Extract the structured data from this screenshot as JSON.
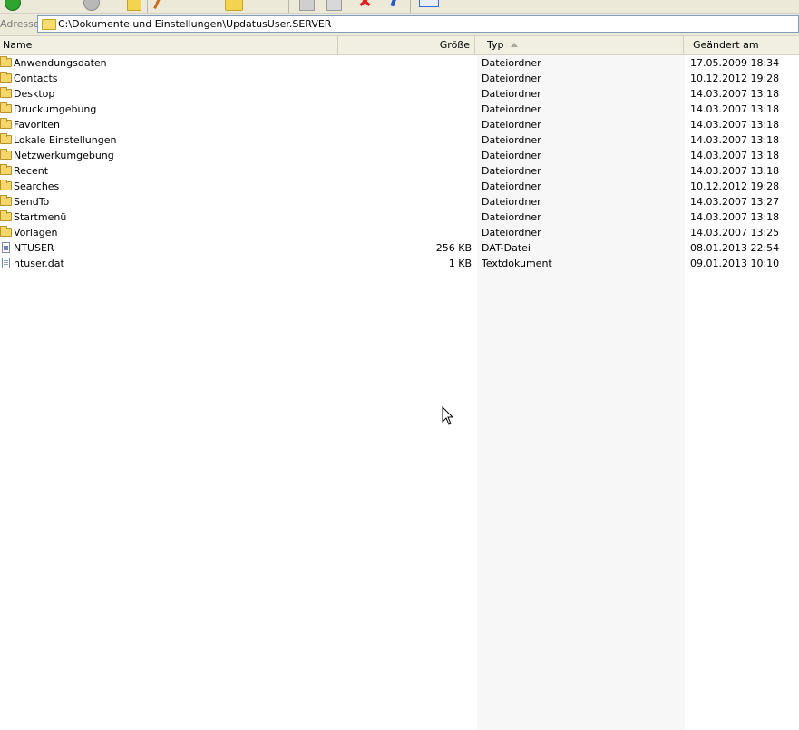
{
  "address": {
    "label": "Adresse",
    "path": "C:\\Dokumente und Einstellungen\\UpdatusUser.SERVER"
  },
  "columns": {
    "name": "Name",
    "size": "Größe",
    "type": "Typ",
    "modified": "Geändert am"
  },
  "toolbar": {
    "icons": [
      "back-icon",
      "forward-icon",
      "up-folder-icon",
      "search-icon",
      "folders-icon",
      "move-to-icon",
      "copy-to-icon",
      "delete-icon",
      "undo-icon",
      "views-icon"
    ]
  },
  "files": [
    {
      "name": "Anwendungsdaten",
      "size": "",
      "type": "Dateiordner",
      "modified": "17.05.2009 18:34",
      "icon": "folder-icon"
    },
    {
      "name": "Contacts",
      "size": "",
      "type": "Dateiordner",
      "modified": "10.12.2012 19:28",
      "icon": "folder-icon"
    },
    {
      "name": "Desktop",
      "size": "",
      "type": "Dateiordner",
      "modified": "14.03.2007 13:18",
      "icon": "folder-icon"
    },
    {
      "name": "Druckumgebung",
      "size": "",
      "type": "Dateiordner",
      "modified": "14.03.2007 13:18",
      "icon": "folder-icon"
    },
    {
      "name": "Favoriten",
      "size": "",
      "type": "Dateiordner",
      "modified": "14.03.2007 13:18",
      "icon": "folder-icon"
    },
    {
      "name": "Lokale Einstellungen",
      "size": "",
      "type": "Dateiordner",
      "modified": "14.03.2007 13:18",
      "icon": "folder-icon"
    },
    {
      "name": "Netzwerkumgebung",
      "size": "",
      "type": "Dateiordner",
      "modified": "14.03.2007 13:18",
      "icon": "folder-icon"
    },
    {
      "name": "Recent",
      "size": "",
      "type": "Dateiordner",
      "modified": "14.03.2007 13:18",
      "icon": "folder-icon"
    },
    {
      "name": "Searches",
      "size": "",
      "type": "Dateiordner",
      "modified": "10.12.2012 19:28",
      "icon": "folder-icon"
    },
    {
      "name": "SendTo",
      "size": "",
      "type": "Dateiordner",
      "modified": "14.03.2007 13:27",
      "icon": "folder-icon"
    },
    {
      "name": "Startmenü",
      "size": "",
      "type": "Dateiordner",
      "modified": "14.03.2007 13:18",
      "icon": "folder-icon"
    },
    {
      "name": "Vorlagen",
      "size": "",
      "type": "Dateiordner",
      "modified": "14.03.2007 13:25",
      "icon": "folder-icon"
    },
    {
      "name": "NTUSER",
      "size": "256 KB",
      "type": "DAT-Datei",
      "modified": "08.01.2013 22:54",
      "icon": "dat-file-icon"
    },
    {
      "name": "ntuser.dat",
      "size": "1 KB",
      "type": "Textdokument",
      "modified": "09.01.2013 10:10",
      "icon": "text-file-icon"
    }
  ]
}
